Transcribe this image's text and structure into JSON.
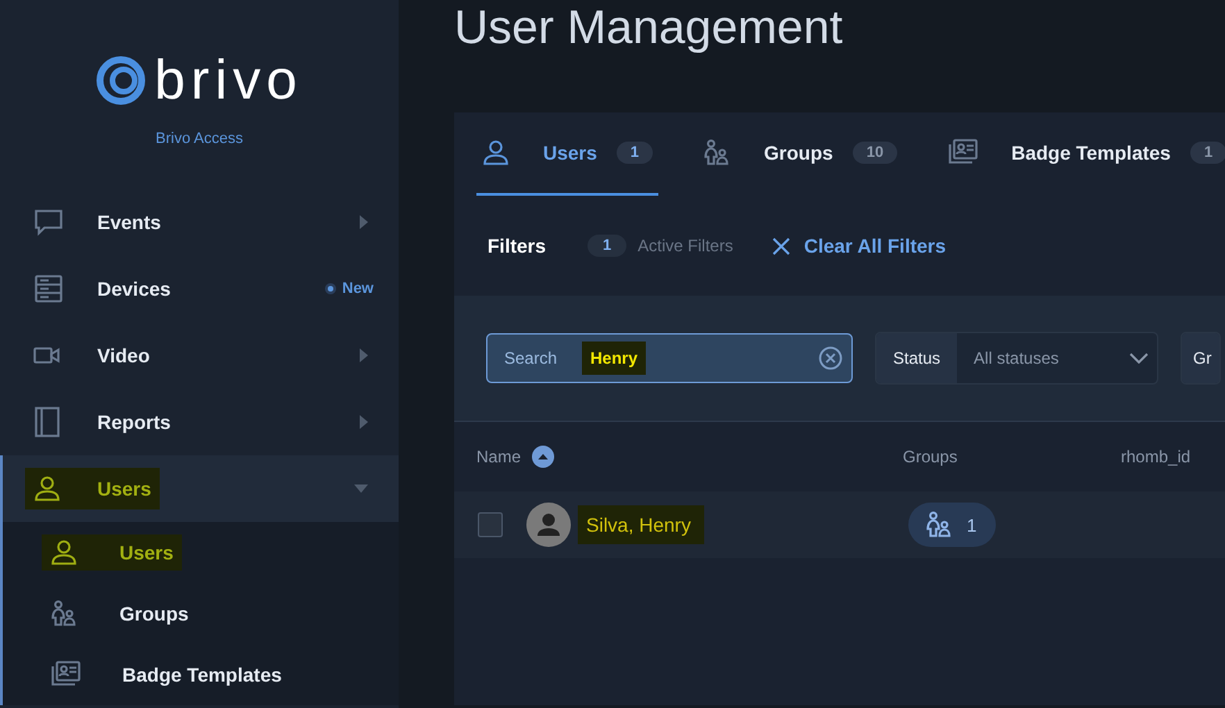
{
  "sidebar": {
    "logo": "brivo",
    "subtitle": "Brivo Access",
    "items": [
      {
        "label": "Events",
        "expanded": false,
        "selected": false,
        "highlighted": false
      },
      {
        "label": "Devices",
        "badge": "New",
        "selected": false,
        "highlighted": false
      },
      {
        "label": "Video",
        "expanded": false,
        "selected": false,
        "highlighted": false
      },
      {
        "label": "Reports",
        "expanded": false,
        "selected": false,
        "highlighted": false
      },
      {
        "label": "Users",
        "expanded": true,
        "selected": true,
        "highlighted": true,
        "children": [
          {
            "label": "Users",
            "selected": true,
            "highlighted": true
          },
          {
            "label": "Groups",
            "selected": false,
            "highlighted": false
          },
          {
            "label": "Badge Templates",
            "selected": false,
            "highlighted": false
          }
        ]
      }
    ]
  },
  "page_title": "User Management",
  "tabs": [
    {
      "label": "Users",
      "count": "1",
      "selected": true
    },
    {
      "label": "Groups",
      "count": "10",
      "selected": false
    },
    {
      "label": "Badge Templates",
      "count": "1",
      "selected": false
    }
  ],
  "filters": {
    "title": "Filters",
    "active_count": "1",
    "active_label": "Active Filters",
    "clear": "Clear All Filters"
  },
  "filter_fields": [
    {
      "kind": "search",
      "label": "Search",
      "value": "Henry",
      "highlighted": true
    },
    {
      "kind": "select",
      "label": "Status",
      "value": "All statuses"
    },
    {
      "kind": "select",
      "label": "Gr"
    }
  ],
  "table": {
    "columns": [
      {
        "label": "Name",
        "sorted": true
      },
      {
        "label": "Groups"
      },
      {
        "label": "rhomb_id"
      }
    ],
    "rows": [
      {
        "checked": false,
        "name": "Silva, Henry",
        "highlighted": true,
        "groups": "1"
      }
    ]
  }
}
